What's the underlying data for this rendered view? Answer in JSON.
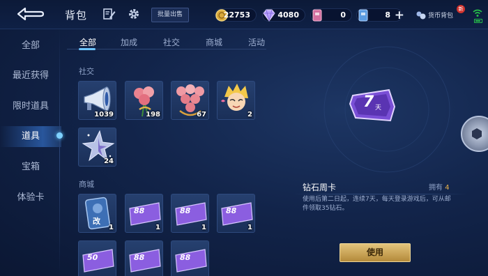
{
  "header": {
    "title": "背包",
    "batch_sell": "批量出售",
    "currencies": {
      "gold": "22753",
      "diamond": "4080",
      "coupon": "0",
      "points": "8"
    },
    "wallet_label": "货币背包",
    "new_badge": "新"
  },
  "sidebar": {
    "items": [
      {
        "label": "全部"
      },
      {
        "label": "最近获得"
      },
      {
        "label": "限时道具"
      },
      {
        "label": "道具"
      },
      {
        "label": "宝箱"
      },
      {
        "label": "体验卡"
      }
    ],
    "active_index": 3
  },
  "tabs": [
    {
      "label": "全部"
    },
    {
      "label": "加成"
    },
    {
      "label": "社交"
    },
    {
      "label": "商城"
    },
    {
      "label": "活动"
    }
  ],
  "sections": {
    "social": {
      "label": "社交",
      "items": [
        {
          "icon": "megaphone-icon",
          "count": "1039"
        },
        {
          "icon": "rose-icon",
          "count": "198"
        },
        {
          "icon": "rose-bouquet-icon",
          "count": "67"
        },
        {
          "icon": "hero-avatar-icon",
          "count": "2"
        },
        {
          "icon": "star-icon",
          "count": "24"
        }
      ]
    },
    "shop": {
      "label": "商城",
      "items": [
        {
          "icon": "rename-card-icon",
          "card_text": "改",
          "count": "1"
        },
        {
          "icon": "coupon-icon",
          "card_text": "88",
          "count": "1"
        },
        {
          "icon": "coupon-icon",
          "card_text": "88",
          "count": "1"
        },
        {
          "icon": "coupon-icon",
          "card_text": "88",
          "count": "1"
        },
        {
          "icon": "coupon-icon",
          "card_text": "50",
          "count": ""
        },
        {
          "icon": "coupon-icon",
          "card_text": "88",
          "count": ""
        },
        {
          "icon": "coupon-icon",
          "card_text": "88",
          "count": ""
        }
      ]
    }
  },
  "detail": {
    "card_text": "7",
    "card_sub": "天",
    "name": "钻石周卡",
    "own_label": "拥有",
    "own_count": "4",
    "description": "使用后第二日起，连续7天，每天登录游戏后，可从邮件领取35钻石。",
    "use_button": "使用"
  },
  "colors": {
    "accent": "#6ec5ff",
    "gold_button": "#d4b063",
    "purple_card": "#7a4fd6"
  }
}
